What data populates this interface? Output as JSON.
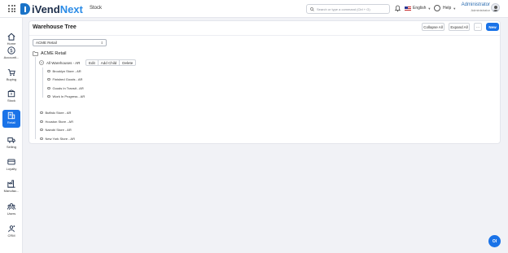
{
  "header": {
    "brand_part1": "iVend",
    "brand_part2": "Next",
    "module": "Stock",
    "search_placeholder": "Search or type a command (Ctrl + G)",
    "language": "English",
    "help": "Help",
    "user_name": "Administrator",
    "user_role": "Administrator"
  },
  "sidebar": {
    "items": [
      {
        "label": "Home",
        "icon": "home-icon"
      },
      {
        "label": "Accounti...",
        "icon": "dollar-icon"
      },
      {
        "label": "Buying",
        "icon": "cart-icon"
      },
      {
        "label": "Stock",
        "icon": "box-icon"
      },
      {
        "label": "Retail",
        "icon": "store-icon",
        "active": true
      },
      {
        "label": "Selling",
        "icon": "truck-icon"
      },
      {
        "label": "Loyalty",
        "icon": "card-icon"
      },
      {
        "label": "Manufac...",
        "icon": "factory-icon"
      },
      {
        "label": "Users",
        "icon": "users-icon"
      },
      {
        "label": "CRM",
        "icon": "crm-icon"
      }
    ]
  },
  "page": {
    "title": "Warehouse Tree",
    "collapse_all": "Collapse All",
    "expand_all": "Expand All",
    "more": "···",
    "new": "New",
    "company_select": "ACME Retail"
  },
  "tree": {
    "root": "ACME Retail",
    "all_warehouses": "All Warehouses - AR",
    "actions": {
      "edit": "Edit",
      "add_child": "Add Child",
      "delete": "Delete"
    },
    "children": [
      "Brooklyn Store - AR",
      "Finished Goods - AR",
      "Goods In Transit - AR",
      "Work In Progress - AR"
    ],
    "siblings": [
      "Buffalo Store - AR",
      "Houston Store - AR",
      "Nairobi Store - AR",
      "New York Store - AR"
    ]
  },
  "chat": {
    "label": "OI"
  },
  "colors": {
    "accent": "#1a73e8",
    "brand_dark": "#1c2d4a",
    "brand_light": "#2b8be6"
  }
}
